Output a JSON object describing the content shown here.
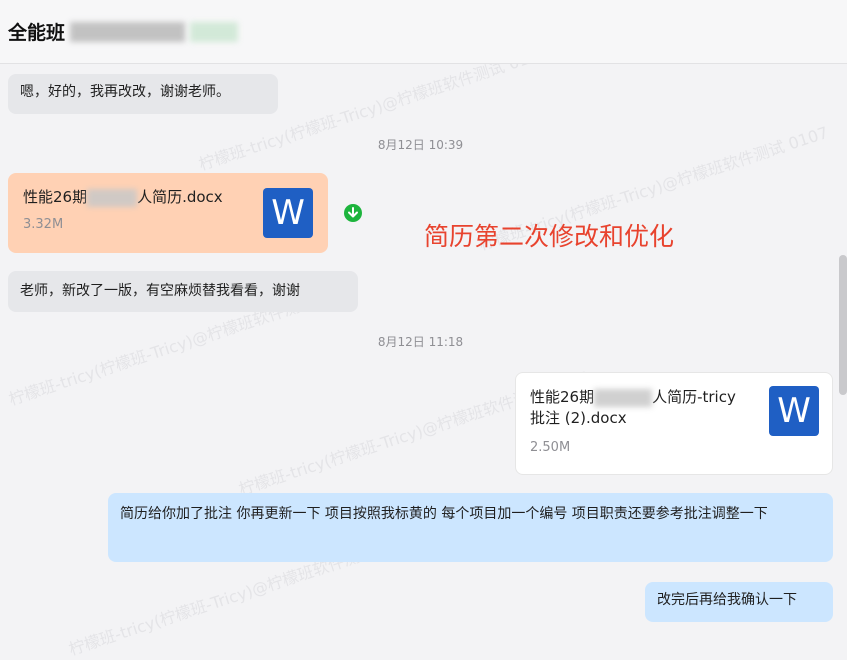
{
  "header": {
    "title": "全能班"
  },
  "messages": {
    "m1": "嗯，好的，我再改改，谢谢老师。",
    "t1": "8月12日 10:39",
    "file1": {
      "name_a": "性能26期",
      "name_b": "人简历.docx",
      "size": "3.32M"
    },
    "m2": "老师，新改了一版，有空麻烦替我看看，谢谢",
    "t2": "8月12日 11:18",
    "file2": {
      "name_a": "性能26期",
      "name_b": "人简历-tricy",
      "name_c": "批注 (2).docx",
      "size": "2.50M"
    },
    "m3": "简历给你加了批注 你再更新一下  项目按照我标黄的  每个项目加一个编号 项目职责还要参考批注调整一下",
    "m4": "改完后再给我确认一下"
  },
  "annotation": "简历第二次修改和优化",
  "icons": {
    "word": "word-document-icon",
    "download": "download-icon",
    "word_letter": "W"
  },
  "watermark": "柠檬班-tricy(柠檬班-Tricy)@柠檬班软件测试 0107",
  "colors": {
    "orange_card": "#ffd1b4",
    "blue_bubble": "#cce6ff",
    "gray_bubble": "#e6e7ea",
    "annotation": "#e8432e",
    "word_blue": "#1f5fc4",
    "download_green": "#1db43d"
  }
}
